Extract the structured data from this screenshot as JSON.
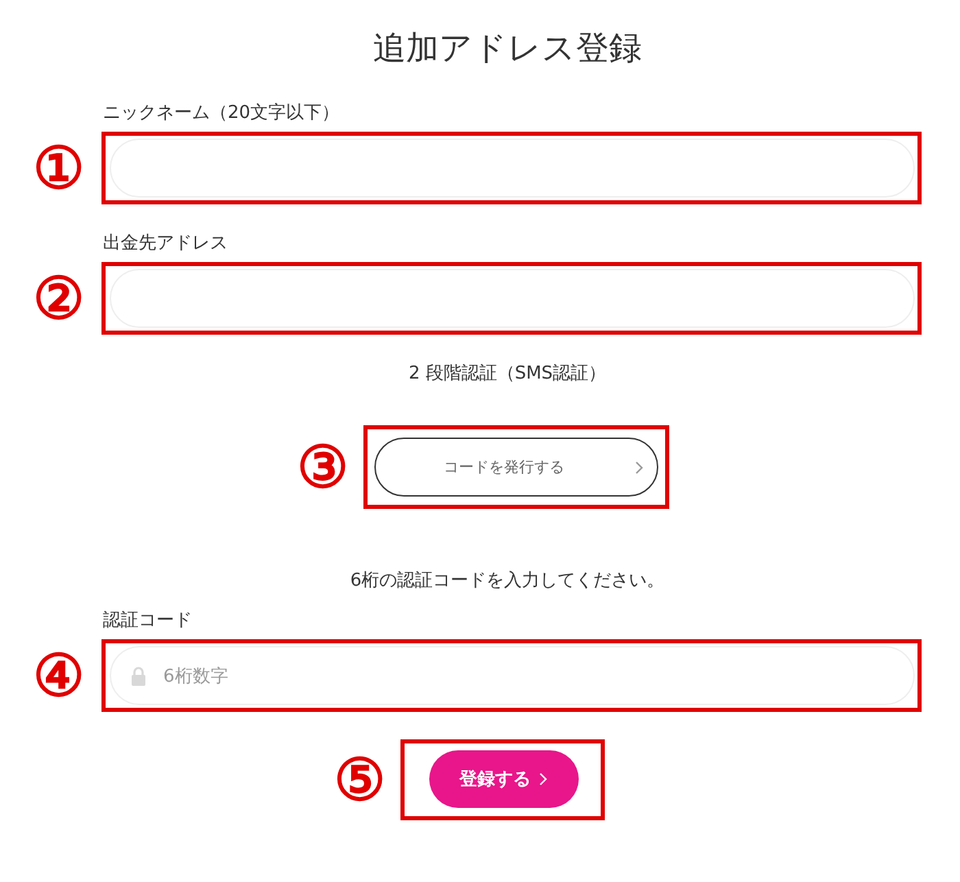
{
  "title": "追加アドレス登録",
  "items": [
    {
      "kind": "field",
      "label": "ニックネーム（20文字以下）",
      "marker": "①"
    },
    {
      "kind": "field",
      "label": "出金先アドレス",
      "marker": "②"
    },
    {
      "kind": "note",
      "text": "2 段階認証（SMS認証）"
    },
    {
      "kind": "outline-button",
      "label": "コードを発行する",
      "marker": "③"
    },
    {
      "kind": "note",
      "text": "6桁の認証コードを入力してください。"
    },
    {
      "kind": "code-field",
      "label": "認証コード",
      "placeholder": "6桁数字",
      "marker": "④"
    },
    {
      "kind": "primary-button",
      "label": "登録する",
      "marker": "⑤"
    }
  ]
}
